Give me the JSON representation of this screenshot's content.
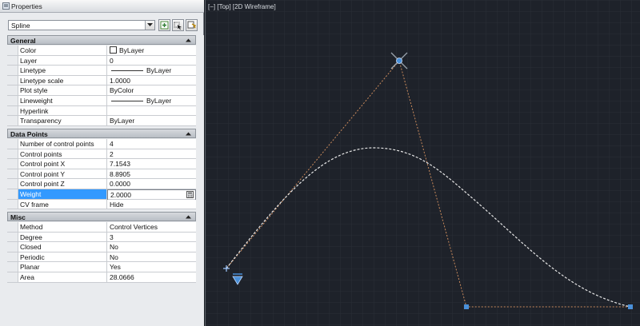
{
  "panel": {
    "title": "Properties",
    "object_type": "Spline",
    "buttons": [
      "toggle-pickadd",
      "select-objects",
      "quick-select"
    ]
  },
  "sections": {
    "general": {
      "label": "General",
      "rows": [
        {
          "key": "Color",
          "value": "ByLayer"
        },
        {
          "key": "Layer",
          "value": "0"
        },
        {
          "key": "Linetype",
          "value": "ByLayer"
        },
        {
          "key": "Linetype scale",
          "value": "1.0000"
        },
        {
          "key": "Plot style",
          "value": "ByColor"
        },
        {
          "key": "Lineweight",
          "value": "ByLayer"
        },
        {
          "key": "Hyperlink",
          "value": ""
        },
        {
          "key": "Transparency",
          "value": "ByLayer"
        }
      ]
    },
    "data_points": {
      "label": "Data Points",
      "rows": [
        {
          "key": "Number of control points",
          "value": "4"
        },
        {
          "key": "Control points",
          "value": "2"
        },
        {
          "key": "Control point X",
          "value": "7.1543"
        },
        {
          "key": "Control point Y",
          "value": "8.8905"
        },
        {
          "key": "Control point Z",
          "value": "0.0000"
        },
        {
          "key": "Weight",
          "value": "2.0000"
        },
        {
          "key": "CV frame",
          "value": "Hide"
        }
      ]
    },
    "misc": {
      "label": "Misc",
      "rows": [
        {
          "key": "Method",
          "value": "Control Vertices"
        },
        {
          "key": "Degree",
          "value": "3"
        },
        {
          "key": "Closed",
          "value": "No"
        },
        {
          "key": "Periodic",
          "value": "No"
        },
        {
          "key": "Planar",
          "value": "Yes"
        },
        {
          "key": "Area",
          "value": "28.0666"
        }
      ]
    }
  },
  "viewport": {
    "label": "[−] [Top] [2D Wireframe]"
  },
  "colors": {
    "selected_row": "#3399ff",
    "canvas_bg": "#1e222a",
    "grid": "#2b3038",
    "cv_frame": "#c98a5c",
    "spline": "#e6e6e6",
    "grip": "#4a90d9"
  },
  "icons": [
    "properties-icon",
    "dropdown-arrow-icon",
    "pickadd-icon",
    "select-objects-icon",
    "quick-select-icon",
    "collapse-icon",
    "calculator-icon",
    "grip-icon",
    "insertion-marker-icon"
  ]
}
